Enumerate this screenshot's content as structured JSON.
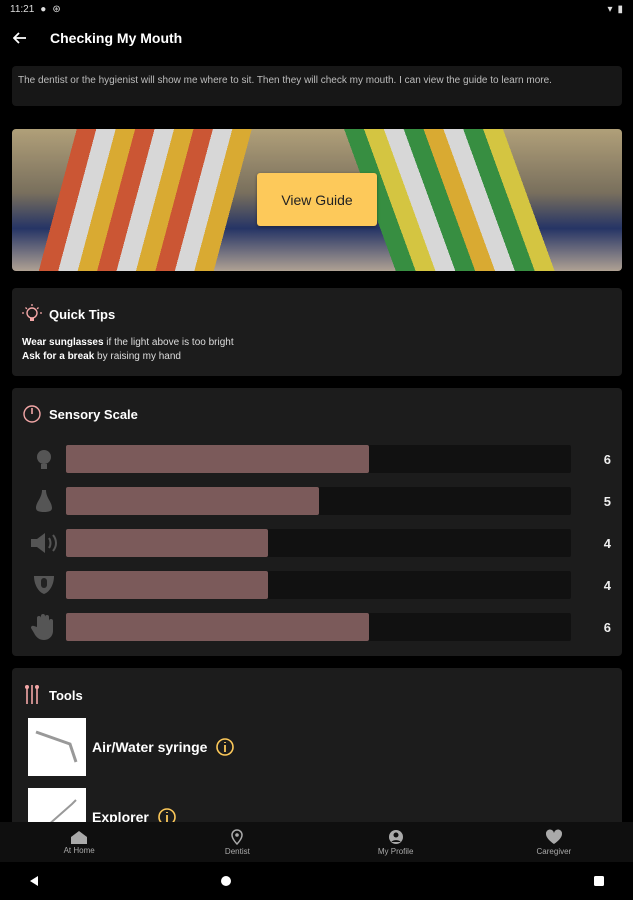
{
  "status": {
    "time": "11:21"
  },
  "header": {
    "title": "Checking My Mouth"
  },
  "intro": {
    "text": "The dentist or the hygienist will show me where to sit. Then they will check my mouth. I can view the guide to learn more."
  },
  "hero": {
    "button_label": "View Guide"
  },
  "tips": {
    "title": "Quick Tips",
    "lines": [
      {
        "bold": "Wear sunglasses",
        "rest": " if the light above is too bright"
      },
      {
        "bold": "Ask for a break",
        "rest": " by raising my hand"
      }
    ]
  },
  "scale": {
    "title": "Sensory Scale",
    "max": 10,
    "items": [
      {
        "icon": "lightbulb-icon",
        "value": 6
      },
      {
        "icon": "nose-icon",
        "value": 5
      },
      {
        "icon": "speaker-icon",
        "value": 4
      },
      {
        "icon": "mouth-taste-icon",
        "value": 4
      },
      {
        "icon": "hand-touch-icon",
        "value": 6
      }
    ]
  },
  "tools": {
    "title": "Tools",
    "items": [
      {
        "name": "Air/Water syringe",
        "icon": "info-icon"
      },
      {
        "name": "Explorer",
        "icon": "info-icon"
      }
    ]
  },
  "nav": {
    "items": [
      {
        "label": "At Home",
        "icon": "home-icon"
      },
      {
        "label": "Dentist",
        "icon": "location-pin-icon"
      },
      {
        "label": "My Profile",
        "icon": "profile-icon"
      },
      {
        "label": "Caregiver",
        "icon": "heart-hands-icon"
      }
    ]
  },
  "colors": {
    "accent": "#fdc95a",
    "bar": "#7b5a5a",
    "icon_pink": "#f2a6a6"
  }
}
